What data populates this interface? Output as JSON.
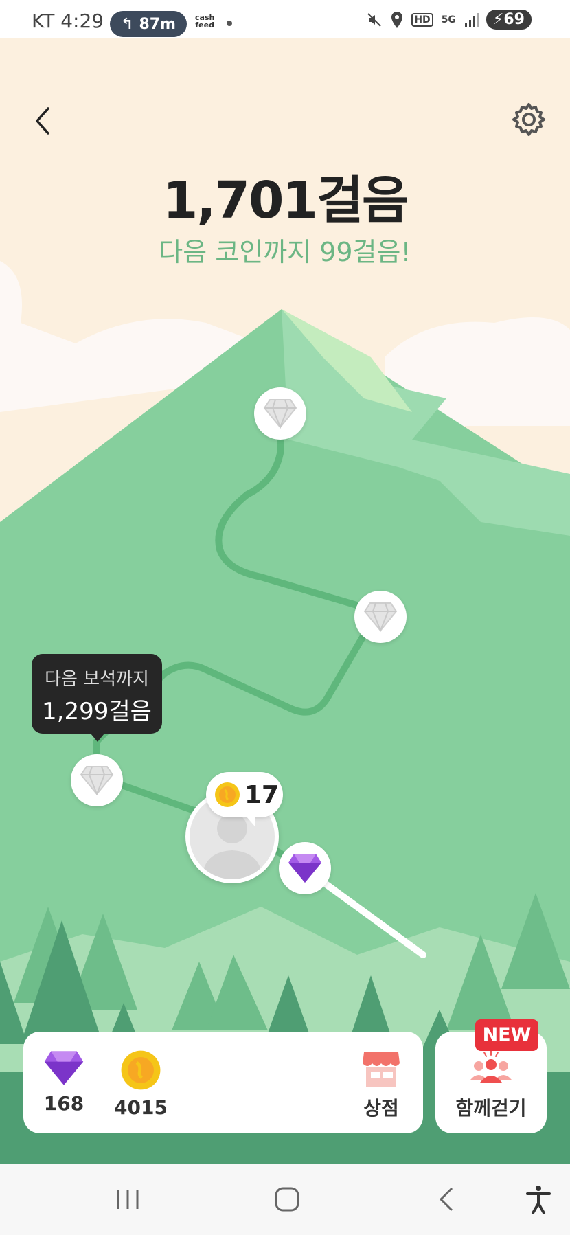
{
  "status_bar": {
    "carrier_time": "KT 4:29",
    "nav_distance": "87m",
    "cash_top": "cash",
    "cash_bottom": "feed",
    "hd": "HD",
    "net": "5G",
    "battery": "69"
  },
  "header": {
    "steps": "1,701걸음",
    "next_coin": "다음 코인까지 99걸음!"
  },
  "tooltip": {
    "line1": "다음 보석까지",
    "line2": "1,299걸음"
  },
  "avatar": {
    "coin_count": "17"
  },
  "wallet": {
    "gems": "168",
    "coins": "4015",
    "shop_label": "상점"
  },
  "walk_together": {
    "label": "함께걷기",
    "badge": "NEW"
  },
  "colors": {
    "sky": "#fcf0df",
    "mountain": "#86cf9d",
    "path": "#5fb77c",
    "accent_gem": "#9b4fe0",
    "coin": "#f5c518",
    "badge": "#e8313b"
  }
}
